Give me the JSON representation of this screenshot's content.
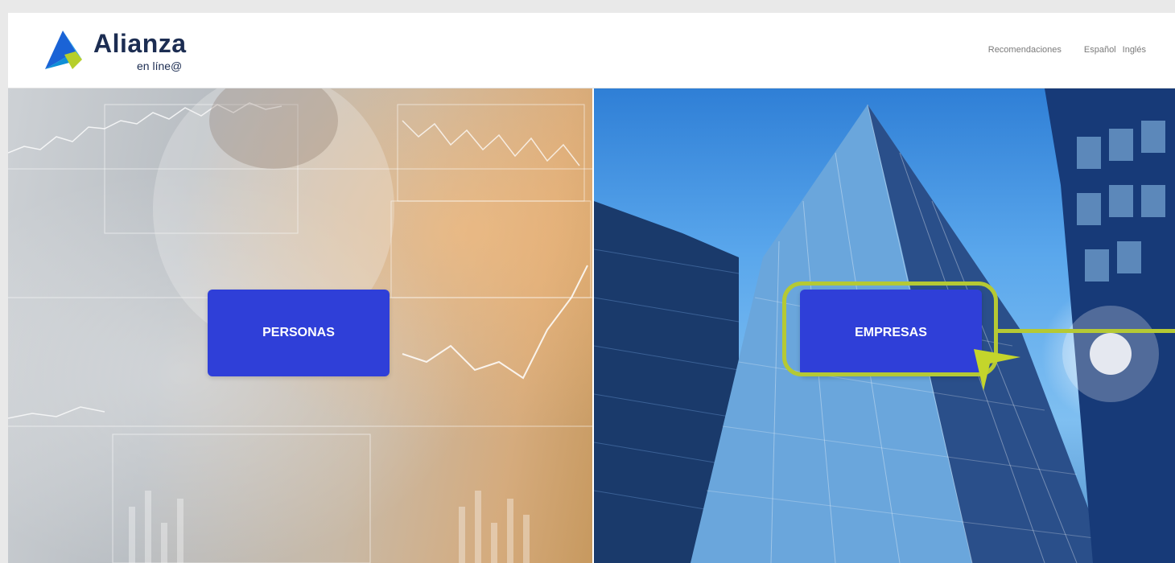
{
  "brand": {
    "name": "Alianza",
    "subtitle": "en líne@"
  },
  "nav": {
    "recomendaciones": "Recomendaciones",
    "lang_es": "Español",
    "lang_en": "Inglés"
  },
  "hero": {
    "personas_label": "PERSONAS",
    "empresas_label": "EMPRESAS"
  },
  "colors": {
    "cta": "#2f3fd8",
    "highlight": "#b5c934",
    "brand_text": "#1c2d52"
  },
  "icons": {
    "logo": "alianza-logo-icon",
    "pointer": "arrow-pointer-icon"
  }
}
